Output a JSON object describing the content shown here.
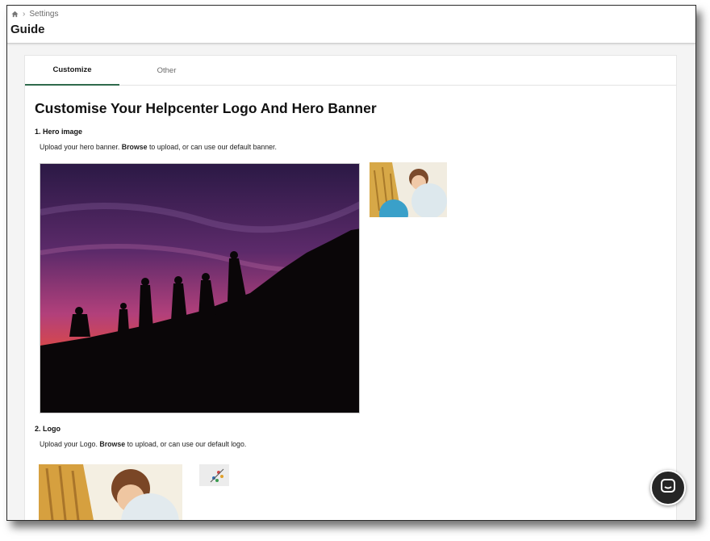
{
  "breadcrumb": {
    "home_icon": "home-icon",
    "separator": "›",
    "current": "Settings"
  },
  "page": {
    "title": "Guide"
  },
  "tabs": [
    {
      "label": "Customize",
      "active": true
    },
    {
      "label": "Other",
      "active": false
    }
  ],
  "content": {
    "heading": "Customise Your Helpcenter Logo And Hero Banner",
    "hero": {
      "label": "1. Hero image",
      "desc_before": "Upload your hero banner.",
      "desc_link": "Browse",
      "desc_after": "to upload, or can use our default banner."
    },
    "logo": {
      "label": "2. Logo",
      "desc_before": "Upload your Logo.",
      "desc_link": "Browse",
      "desc_after": "to upload, or can use our default logo."
    }
  },
  "chat": {
    "icon": "chat-icon"
  },
  "colors": {
    "active_tab_underline": "#2f6a4c",
    "chat_button": "#262626"
  }
}
